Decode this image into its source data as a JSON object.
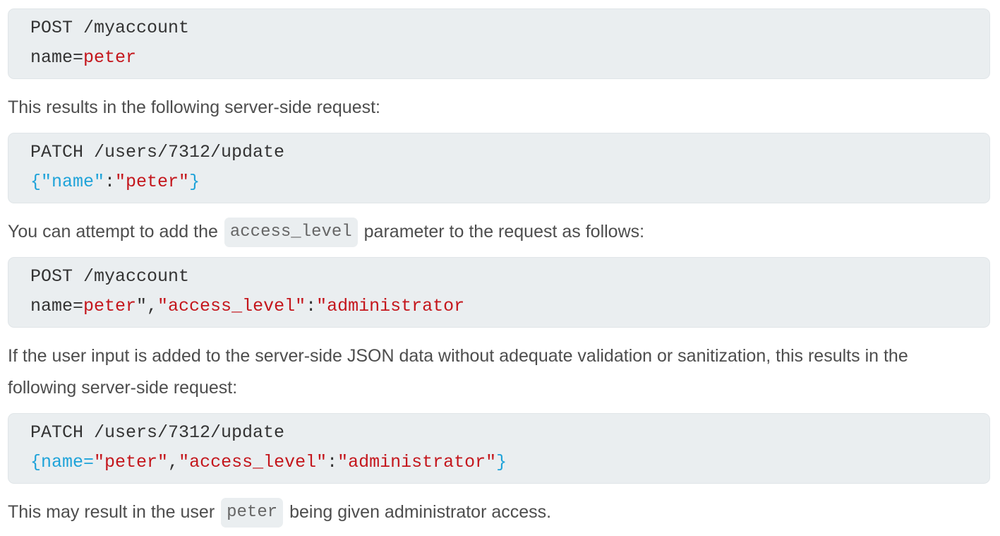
{
  "blocks": {
    "b1": {
      "line1": "POST /myaccount",
      "line2_plain": "name=",
      "line2_red": "peter"
    },
    "p1": "This results in the following server-side request:",
    "b2": {
      "line1": "PATCH /users/7312/update",
      "line2_open": "{",
      "line2_key": "\"name\"",
      "line2_colon": ":",
      "line2_val": "\"peter\"",
      "line2_close": "}"
    },
    "p2": {
      "before": "You can attempt to add the",
      "code": "access_level",
      "after": "parameter to the request as follows:"
    },
    "b3": {
      "line1": "POST /myaccount",
      "line2_plain": "name=",
      "line2_red1": "peter",
      "line2_dark1": "\",",
      "line2_red2": "\"access_level\"",
      "line2_dark2": ":",
      "line2_red3": "\"administrator"
    },
    "p3": {
      "line1": "If the user input is added to the server-side JSON data without adequate validation or sanitization, this results in the",
      "line2": "following server-side request:"
    },
    "b4": {
      "line1": "PATCH /users/7312/update",
      "line2_blue1": "{name=",
      "line2_red1": "\"peter\"",
      "line2_dark1": ",",
      "line2_red2": "\"access_level\"",
      "line2_dark2": ":",
      "line2_red3": "\"administrator\"",
      "line2_blue2": "}"
    },
    "p4": {
      "before": "This may result in the user",
      "code": "peter",
      "after": "being given administrator access."
    }
  }
}
